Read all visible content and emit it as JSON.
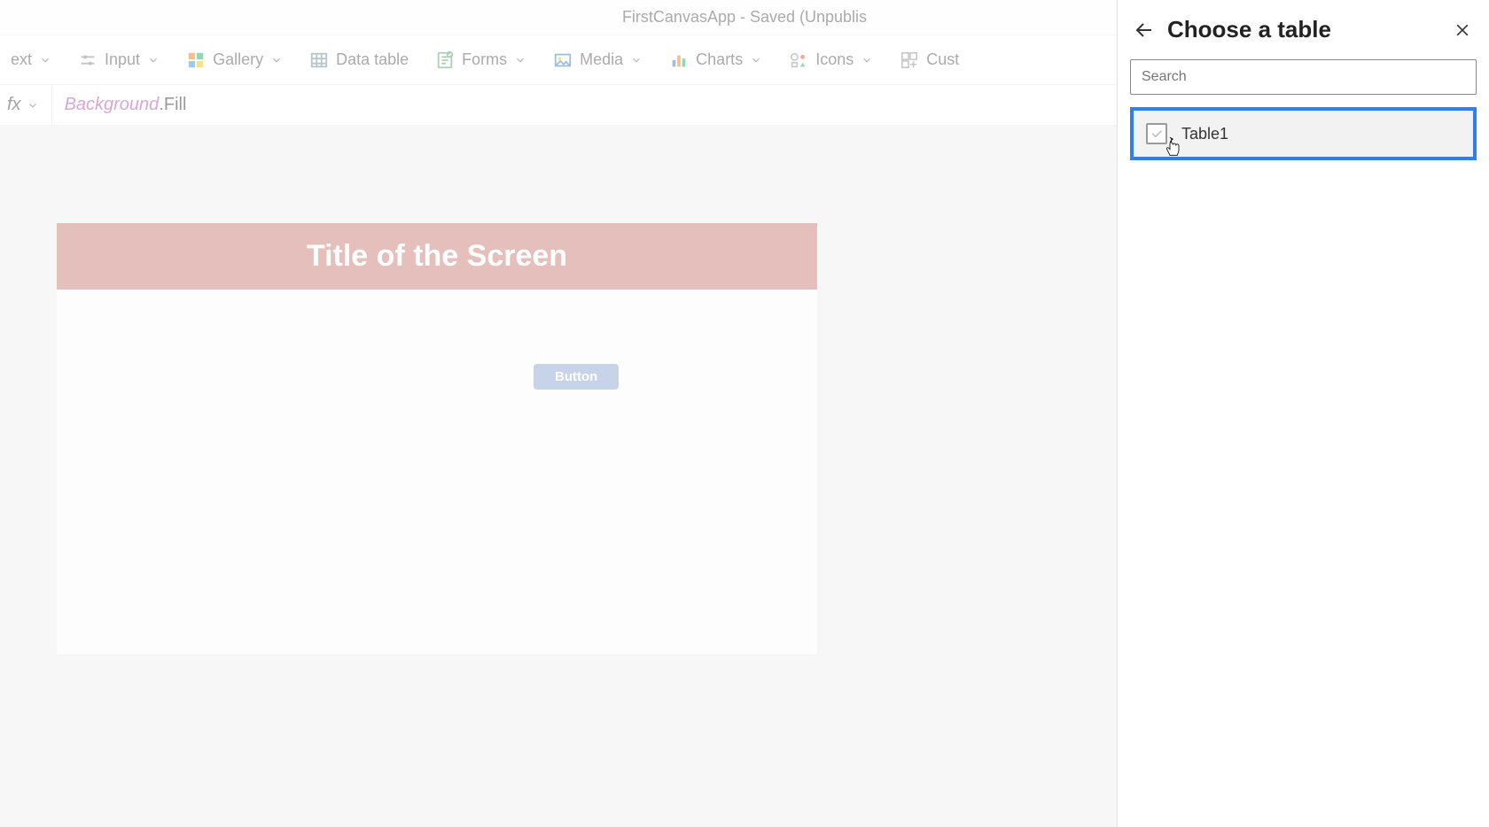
{
  "titlebar": {
    "text": "FirstCanvasApp - Saved (Unpublis"
  },
  "toolbar": {
    "text": {
      "label": "ext"
    },
    "input": {
      "label": "Input"
    },
    "gallery": {
      "label": "Gallery"
    },
    "data_table": {
      "label": "Data table"
    },
    "forms": {
      "label": "Forms"
    },
    "media": {
      "label": "Media"
    },
    "charts": {
      "label": "Charts"
    },
    "icons": {
      "label": "Icons"
    },
    "custom": {
      "label": "Cust"
    }
  },
  "formula_bar": {
    "fx_label": "fx",
    "obj": "Background",
    "prop": ".Fill"
  },
  "canvas": {
    "title": "Title of the Screen",
    "button_label": "Button"
  },
  "side_panel": {
    "title": "Choose a table",
    "search_placeholder": "Search",
    "tables": [
      {
        "name": "Table1"
      }
    ]
  },
  "colors": {
    "title_bg": "#c97f77",
    "button_bg": "#8ea7d1",
    "selection_border": "#2f80ed"
  }
}
